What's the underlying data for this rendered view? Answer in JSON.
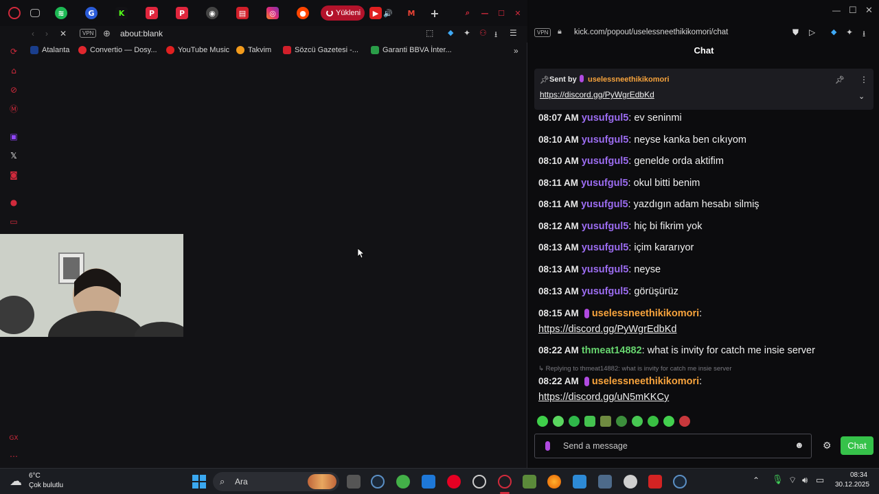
{
  "left_browser": {
    "loading_tab_label": "Yükleni",
    "address": "about:blank",
    "vpn_label": "VPN",
    "bookmarks": [
      {
        "label": "Atalanta",
        "color": "#1a3e8c"
      },
      {
        "label": "Convertio — Dosy...",
        "color": "#e0272e"
      },
      {
        "label": "YouTube Music",
        "color": "#e02020"
      },
      {
        "label": "Takvim",
        "color": "#f29b1c"
      },
      {
        "label": "Sözcü Gazetesi -...",
        "color": "#d11f2a"
      },
      {
        "label": "Garanti BBVA İnter...",
        "color": "#2a9d48"
      }
    ]
  },
  "right_browser": {
    "vpn_label": "VPN",
    "address": "kick.com/popout/uselessneethikikomori/chat",
    "chat_title": "Chat",
    "pinned": {
      "sent_by_label": "Sent by",
      "sender": "uselessneethikikomori",
      "link": "https://discord.gg/PyWgrEdbKd"
    },
    "messages": [
      {
        "time": "08:07 AM",
        "user": "yusufgul5",
        "text": "ev seninmi"
      },
      {
        "time": "08:10 AM",
        "user": "yusufgul5",
        "text": "neyse kanka ben cıkıyom"
      },
      {
        "time": "08:10 AM",
        "user": "yusufgul5",
        "text": "genelde orda aktifim"
      },
      {
        "time": "08:11 AM",
        "user": "yusufgul5",
        "text": "okul bitti benim"
      },
      {
        "time": "08:11 AM",
        "user": "yusufgul5",
        "text": "yazdıgın adam hesabı silmiş"
      },
      {
        "time": "08:12 AM",
        "user": "yusufgul5",
        "text": "hiç bi fikrim yok"
      },
      {
        "time": "08:13 AM",
        "user": "yusufgul5",
        "text": "içim kararıyor"
      },
      {
        "time": "08:13 AM",
        "user": "yusufgul5",
        "text": "neyse"
      },
      {
        "time": "08:13 AM",
        "user": "yusufgul5",
        "text": "görüşürüz"
      }
    ],
    "msg_streamer_1": {
      "time": "08:15 AM",
      "user": "uselessneethikikomori",
      "link": "https://discord.gg/PyWgrEdbKd"
    },
    "msg_thmeat": {
      "time": "08:22 AM",
      "user": "thmeat14882",
      "text": "what is invity for catch me insie server"
    },
    "reply_hint": "Replying to thmeat14882: what is invity for catch me insie server",
    "msg_streamer_2": {
      "time": "08:22 AM",
      "user": "uselessneethikikomori",
      "link": "https://discord.gg/uN5mKKCy"
    },
    "input_placeholder": "Send a message",
    "chat_button": "Chat"
  },
  "taskbar": {
    "weather_temp": "6°C",
    "weather_desc": "Çok bulutlu",
    "search_label": "Ara",
    "time": "08:34",
    "date": "30.12.2025"
  },
  "colors": {
    "opera_red": "#d12a3c",
    "kick_green": "#36c24a",
    "user_purple": "#9b6cf0",
    "streamer_orange": "#f7a33c"
  }
}
